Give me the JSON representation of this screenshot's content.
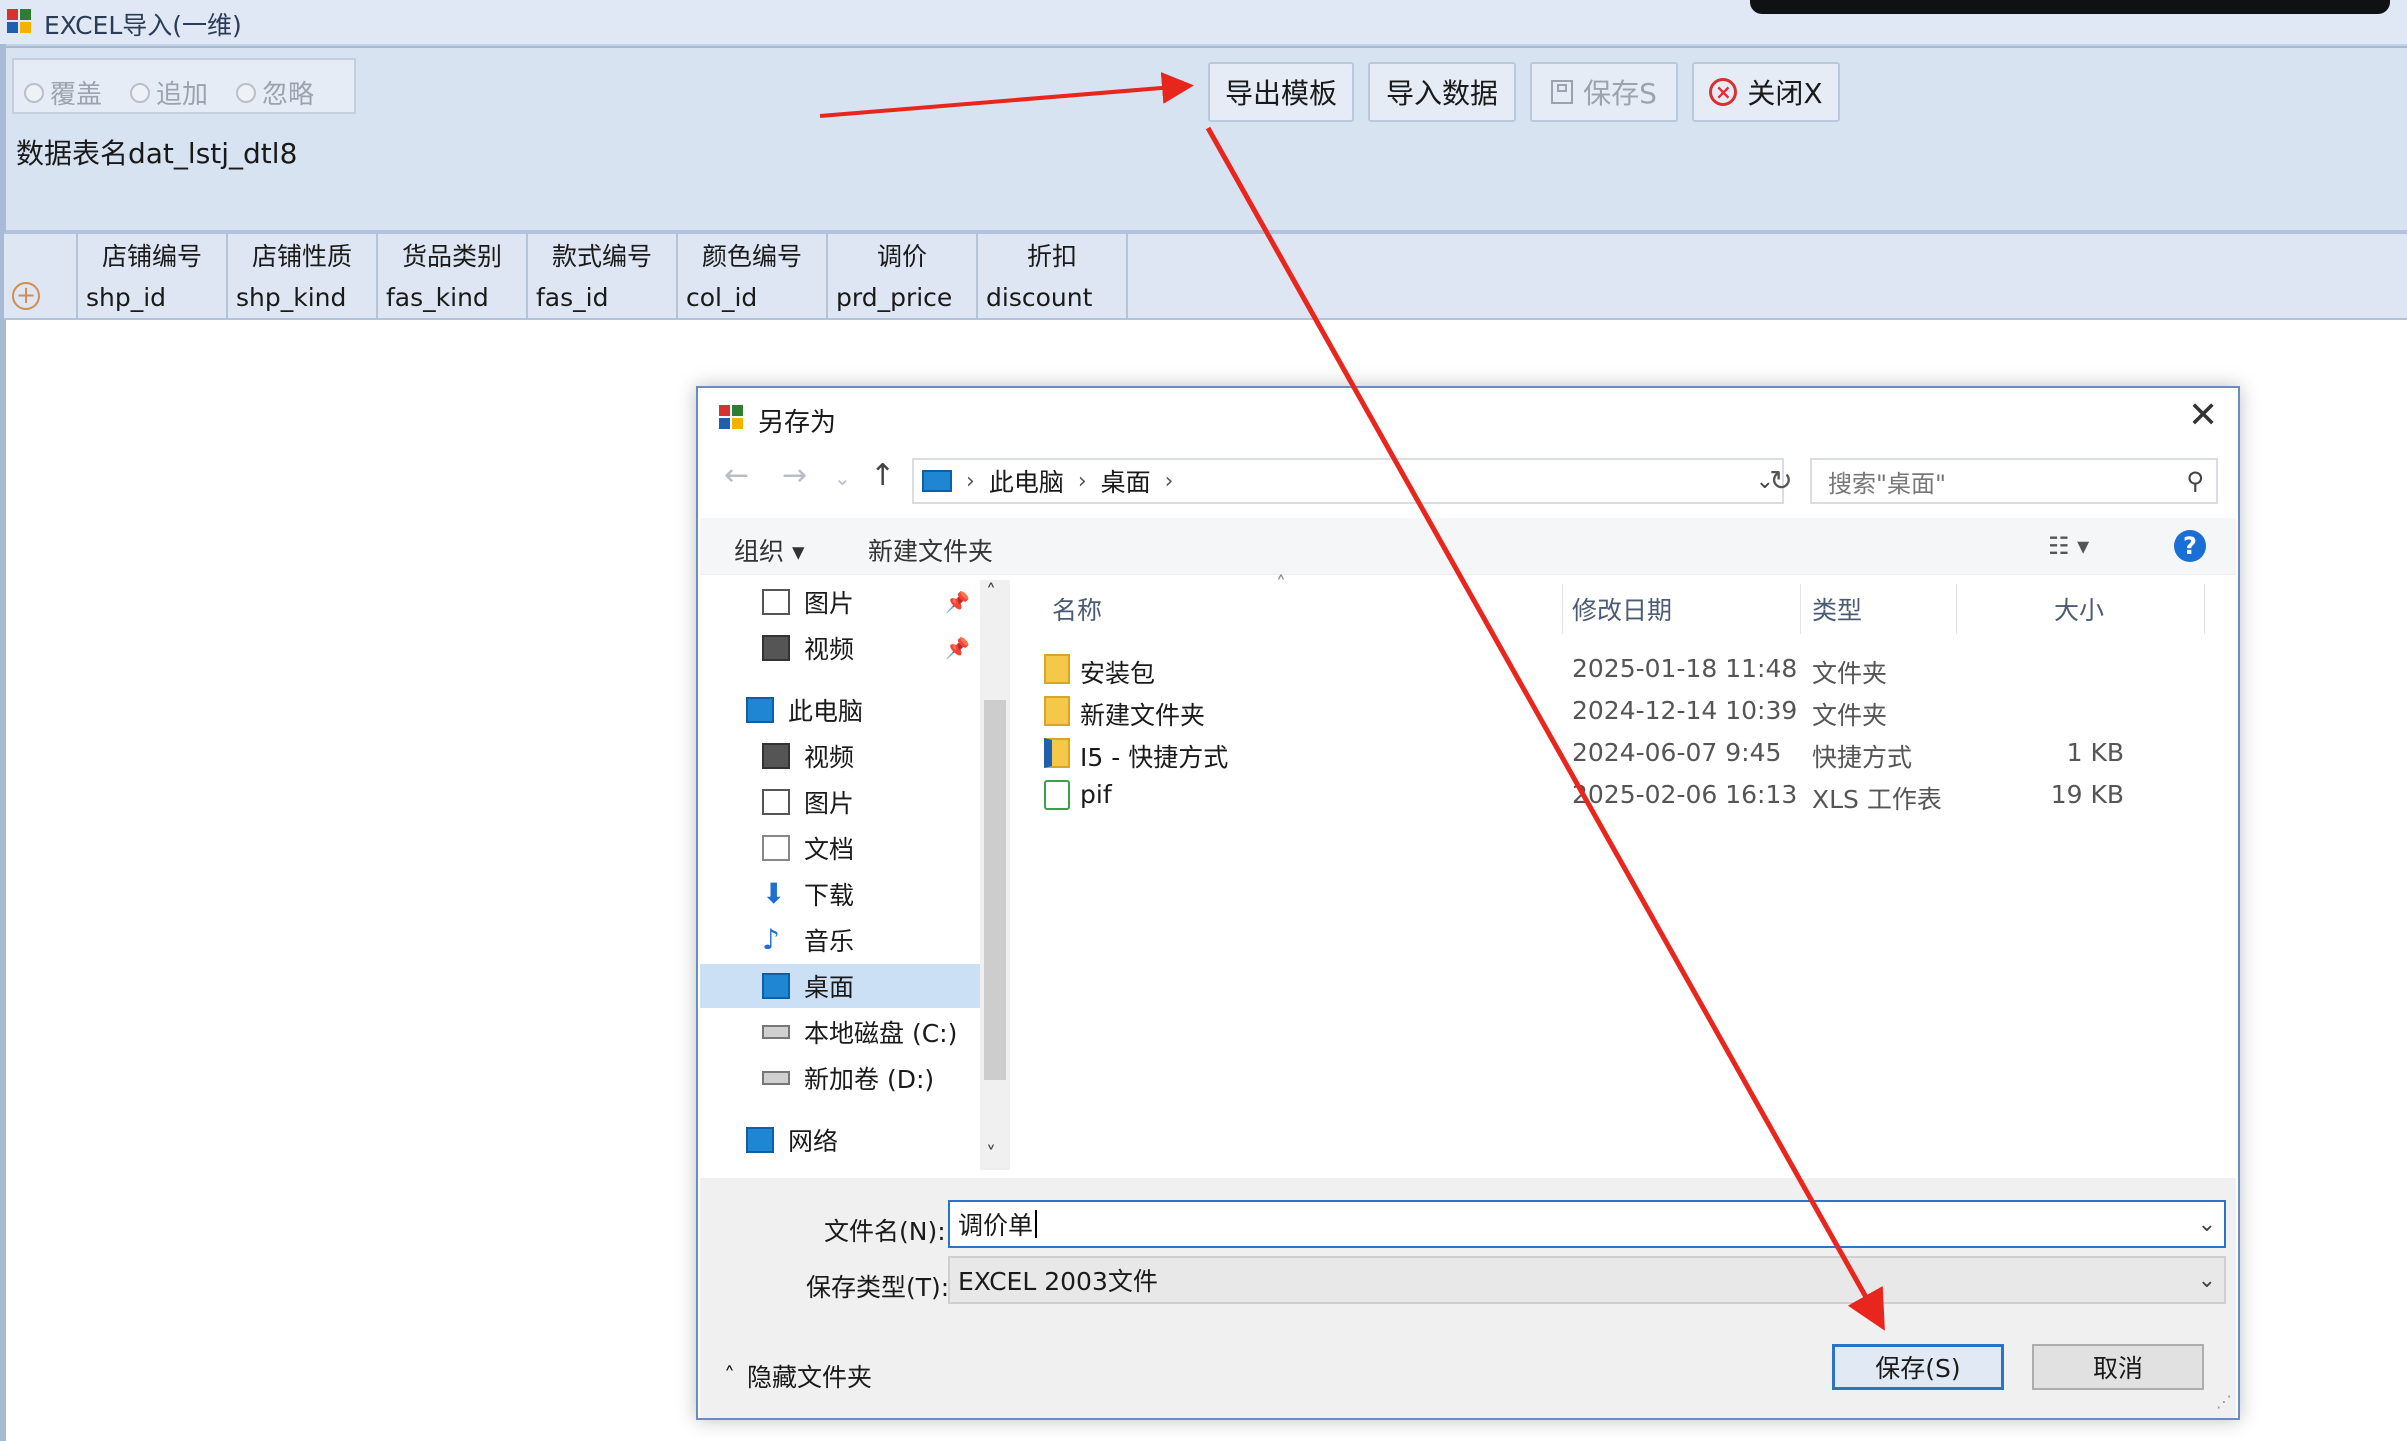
{
  "window": {
    "title": "EXCEL导入(一维)"
  },
  "toolbar": {
    "radio_overwrite": "覆盖",
    "radio_append": "追加",
    "radio_ignore": "忽略",
    "table_name": "数据表名dat_lstj_dtl8",
    "export_template": "导出模板",
    "import_data": "导入数据",
    "save": "保存S",
    "close": "关闭X"
  },
  "grid": {
    "headers": [
      "店铺编号",
      "店铺性质",
      "货品类别",
      "款式编号",
      "颜色编号",
      "调价",
      "折扣"
    ],
    "row": [
      "shp_id",
      "shp_kind",
      "fas_kind",
      "fas_id",
      "col_id",
      "prd_price",
      "discount"
    ]
  },
  "dialog": {
    "title": "另存为",
    "close_glyph": "✕",
    "breadcrumb": [
      "此电脑",
      "桌面"
    ],
    "search_placeholder": "搜索\"桌面\"",
    "organize": "组织 ▾",
    "new_folder": "新建文件夹",
    "help": "?",
    "nav_items": [
      {
        "label": "图片",
        "icon": "pictures-icon",
        "pinned": true
      },
      {
        "label": "视频",
        "icon": "videos-icon",
        "pinned": true
      },
      {
        "label": "此电脑",
        "icon": "pc-icon",
        "pinned": false
      },
      {
        "label": "视频",
        "icon": "videos-icon",
        "pinned": false
      },
      {
        "label": "图片",
        "icon": "pictures-icon",
        "pinned": false
      },
      {
        "label": "文档",
        "icon": "documents-icon",
        "pinned": false
      },
      {
        "label": "下载",
        "icon": "download-icon",
        "pinned": false
      },
      {
        "label": "音乐",
        "icon": "music-icon",
        "pinned": false
      },
      {
        "label": "桌面",
        "icon": "desktop-icon",
        "pinned": false,
        "selected": true
      },
      {
        "label": "本地磁盘 (C:)",
        "icon": "drive-c-icon",
        "pinned": false
      },
      {
        "label": "新加卷 (D:)",
        "icon": "drive-d-icon",
        "pinned": false
      },
      {
        "label": "网络",
        "icon": "network-icon",
        "pinned": false
      }
    ],
    "columns": {
      "name": "名称",
      "modified": "修改日期",
      "type": "类型",
      "size": "大小"
    },
    "files": [
      {
        "name": "安装包",
        "modified": "2025-01-18 11:48",
        "type": "文件夹",
        "size": "",
        "icon": "folder-icon"
      },
      {
        "name": "新建文件夹",
        "modified": "2024-12-14 10:39",
        "type": "文件夹",
        "size": "",
        "icon": "folder-icon"
      },
      {
        "name": "I5 - 快捷方式",
        "modified": "2024-06-07 9:45",
        "type": "快捷方式",
        "size": "1 KB",
        "icon": "shortcut-icon"
      },
      {
        "name": "pif",
        "modified": "2025-02-06 16:13",
        "type": "XLS 工作表",
        "size": "19 KB",
        "icon": "xls-icon"
      }
    ],
    "filename_label": "文件名(N):",
    "filename_value": "调价单",
    "filetype_label": "保存类型(T):",
    "filetype_value": "EXCEL 2003文件",
    "hide_folders": "隐藏文件夹",
    "save_button": "保存(S)",
    "cancel_button": "取消"
  },
  "colors": {
    "arrow": "#e8261d",
    "accent": "#2a73c7",
    "toolbar_bg": "#d8e3f1"
  }
}
